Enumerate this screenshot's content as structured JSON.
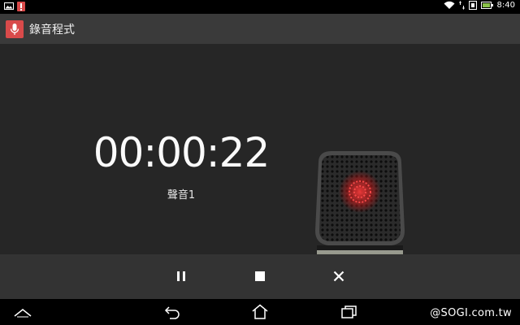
{
  "status_bar": {
    "time": "8:40"
  },
  "app": {
    "title": "錄音程式"
  },
  "recording": {
    "elapsed": "00:00:22",
    "name": "聲音1"
  },
  "controls": {
    "pause": "pause",
    "stop": "stop",
    "discard": "close"
  },
  "navigation": {
    "items": [
      "hide-keyboard",
      "back",
      "home",
      "recent-apps"
    ]
  },
  "watermark": "@SOGI.com.tw",
  "colors": {
    "accent": "#d94a4a",
    "background": "#262626",
    "action_bar": "#3a3a3a",
    "control_bar": "#333333"
  }
}
